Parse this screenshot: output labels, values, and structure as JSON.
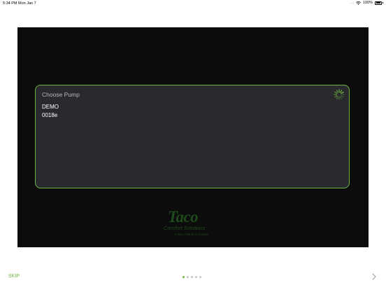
{
  "status_bar": {
    "time": "5:34 PM",
    "date": "Mon Jan 7",
    "signal": "....",
    "battery_percent": "100%",
    "wifi_icon": "wifi-icon",
    "battery_icon": "battery-icon"
  },
  "panel": {
    "title": "Choose Pump",
    "pumps": [
      "DEMO",
      "0018e"
    ],
    "spinner_icon": "loading-spinner-icon"
  },
  "logo": {
    "word": "Taco",
    "sub": "Comfort Solutions",
    "tag": "A Taco Family Company"
  },
  "footer": {
    "skip_label": "SKIP",
    "page_count": 5,
    "current_page": 1,
    "next_icon": "chevron-right-icon"
  },
  "colors": {
    "accent": "#6cb33f",
    "screen_bg": "#0c0c0c",
    "panel_bg": "#2a2a2e",
    "logo": "#1f4a1c"
  }
}
